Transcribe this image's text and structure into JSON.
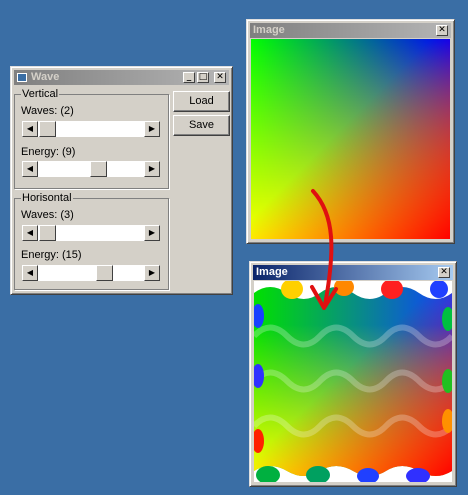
{
  "wave_window": {
    "title": "Wave",
    "buttons": {
      "load": "Load",
      "save": "Save"
    },
    "vertical": {
      "group_label": "Vertical",
      "waves_label": "Waves: (2)",
      "energy_label": "Energy: (9)",
      "waves_value": 2,
      "energy_value": 9
    },
    "horizontal": {
      "group_label": "Horisontal",
      "waves_label": "Waves: (3)",
      "energy_label": "Energy: (15)",
      "waves_value": 3,
      "energy_value": 15
    }
  },
  "image_window_top": {
    "title": "Image"
  },
  "image_window_bottom": {
    "title": "Image"
  },
  "colors": {
    "desktop": "#3a6ea5",
    "arrow": "#e01010",
    "active_title": "#0a246a",
    "inactive_title": "#808080"
  }
}
